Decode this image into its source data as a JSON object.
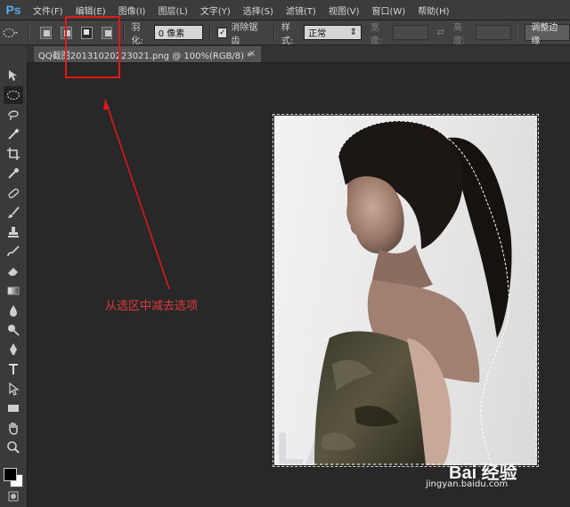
{
  "app": {
    "logo": "Ps"
  },
  "menu": [
    "文件(F)",
    "编辑(E)",
    "图像(I)",
    "图层(L)",
    "文字(Y)",
    "选择(S)",
    "滤镜(T)",
    "视图(V)",
    "窗口(W)",
    "帮助(H)"
  ],
  "options": {
    "feather_label": "羽化:",
    "feather_value": "0 像素",
    "antialias_label": "消除锯齿",
    "antialias_checked": true,
    "style_label": "样式:",
    "style_value": "正常",
    "width_label": "宽度:",
    "height_label": "高度:",
    "refine_button": "调整边缘",
    "selected_mode": "subtract-from-selection"
  },
  "document": {
    "tab_title": "QQ截图20131020223021.png @ 100%(RGB/8) *",
    "close_glyph": "×"
  },
  "annotation": {
    "label": "从选区中减去选项",
    "color": "#e01818"
  },
  "watermark": {
    "brand": "Bai 经验",
    "url": "jingyan.baidu.com"
  },
  "colors": {
    "foreground": "#000000",
    "background": "#ffffff",
    "accent": "#58a8e8"
  },
  "tools": [
    "move-icon",
    "elliptical-marquee-icon",
    "lasso-icon",
    "magic-wand-icon",
    "crop-icon",
    "eyedropper-icon",
    "healing-brush-icon",
    "brush-icon",
    "clone-stamp-icon",
    "history-brush-icon",
    "eraser-icon",
    "gradient-icon",
    "blur-icon",
    "dodge-icon",
    "pen-icon",
    "type-icon",
    "path-selection-icon",
    "rectangle-shape-icon",
    "hand-icon",
    "zoom-icon"
  ]
}
